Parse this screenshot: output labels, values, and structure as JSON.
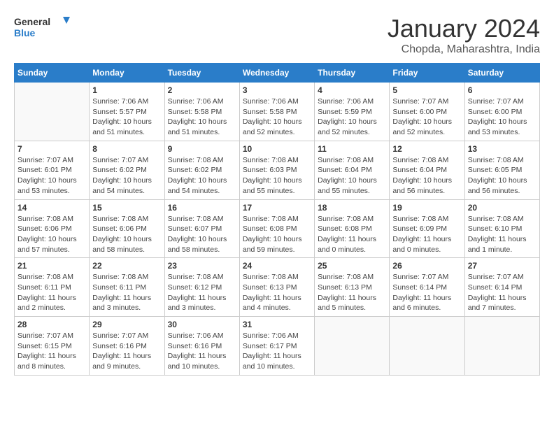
{
  "header": {
    "logo_general": "General",
    "logo_blue": "Blue",
    "month_year": "January 2024",
    "location": "Chopda, Maharashtra, India"
  },
  "weekdays": [
    "Sunday",
    "Monday",
    "Tuesday",
    "Wednesday",
    "Thursday",
    "Friday",
    "Saturday"
  ],
  "weeks": [
    [
      {
        "day": "",
        "info": ""
      },
      {
        "day": "1",
        "info": "Sunrise: 7:06 AM\nSunset: 5:57 PM\nDaylight: 10 hours\nand 51 minutes."
      },
      {
        "day": "2",
        "info": "Sunrise: 7:06 AM\nSunset: 5:58 PM\nDaylight: 10 hours\nand 51 minutes."
      },
      {
        "day": "3",
        "info": "Sunrise: 7:06 AM\nSunset: 5:58 PM\nDaylight: 10 hours\nand 52 minutes."
      },
      {
        "day": "4",
        "info": "Sunrise: 7:06 AM\nSunset: 5:59 PM\nDaylight: 10 hours\nand 52 minutes."
      },
      {
        "day": "5",
        "info": "Sunrise: 7:07 AM\nSunset: 6:00 PM\nDaylight: 10 hours\nand 52 minutes."
      },
      {
        "day": "6",
        "info": "Sunrise: 7:07 AM\nSunset: 6:00 PM\nDaylight: 10 hours\nand 53 minutes."
      }
    ],
    [
      {
        "day": "7",
        "info": "Sunrise: 7:07 AM\nSunset: 6:01 PM\nDaylight: 10 hours\nand 53 minutes."
      },
      {
        "day": "8",
        "info": "Sunrise: 7:07 AM\nSunset: 6:02 PM\nDaylight: 10 hours\nand 54 minutes."
      },
      {
        "day": "9",
        "info": "Sunrise: 7:08 AM\nSunset: 6:02 PM\nDaylight: 10 hours\nand 54 minutes."
      },
      {
        "day": "10",
        "info": "Sunrise: 7:08 AM\nSunset: 6:03 PM\nDaylight: 10 hours\nand 55 minutes."
      },
      {
        "day": "11",
        "info": "Sunrise: 7:08 AM\nSunset: 6:04 PM\nDaylight: 10 hours\nand 55 minutes."
      },
      {
        "day": "12",
        "info": "Sunrise: 7:08 AM\nSunset: 6:04 PM\nDaylight: 10 hours\nand 56 minutes."
      },
      {
        "day": "13",
        "info": "Sunrise: 7:08 AM\nSunset: 6:05 PM\nDaylight: 10 hours\nand 56 minutes."
      }
    ],
    [
      {
        "day": "14",
        "info": "Sunrise: 7:08 AM\nSunset: 6:06 PM\nDaylight: 10 hours\nand 57 minutes."
      },
      {
        "day": "15",
        "info": "Sunrise: 7:08 AM\nSunset: 6:06 PM\nDaylight: 10 hours\nand 58 minutes."
      },
      {
        "day": "16",
        "info": "Sunrise: 7:08 AM\nSunset: 6:07 PM\nDaylight: 10 hours\nand 58 minutes."
      },
      {
        "day": "17",
        "info": "Sunrise: 7:08 AM\nSunset: 6:08 PM\nDaylight: 10 hours\nand 59 minutes."
      },
      {
        "day": "18",
        "info": "Sunrise: 7:08 AM\nSunset: 6:08 PM\nDaylight: 11 hours\nand 0 minutes."
      },
      {
        "day": "19",
        "info": "Sunrise: 7:08 AM\nSunset: 6:09 PM\nDaylight: 11 hours\nand 0 minutes."
      },
      {
        "day": "20",
        "info": "Sunrise: 7:08 AM\nSunset: 6:10 PM\nDaylight: 11 hours\nand 1 minute."
      }
    ],
    [
      {
        "day": "21",
        "info": "Sunrise: 7:08 AM\nSunset: 6:11 PM\nDaylight: 11 hours\nand 2 minutes."
      },
      {
        "day": "22",
        "info": "Sunrise: 7:08 AM\nSunset: 6:11 PM\nDaylight: 11 hours\nand 3 minutes."
      },
      {
        "day": "23",
        "info": "Sunrise: 7:08 AM\nSunset: 6:12 PM\nDaylight: 11 hours\nand 3 minutes."
      },
      {
        "day": "24",
        "info": "Sunrise: 7:08 AM\nSunset: 6:13 PM\nDaylight: 11 hours\nand 4 minutes."
      },
      {
        "day": "25",
        "info": "Sunrise: 7:08 AM\nSunset: 6:13 PM\nDaylight: 11 hours\nand 5 minutes."
      },
      {
        "day": "26",
        "info": "Sunrise: 7:07 AM\nSunset: 6:14 PM\nDaylight: 11 hours\nand 6 minutes."
      },
      {
        "day": "27",
        "info": "Sunrise: 7:07 AM\nSunset: 6:14 PM\nDaylight: 11 hours\nand 7 minutes."
      }
    ],
    [
      {
        "day": "28",
        "info": "Sunrise: 7:07 AM\nSunset: 6:15 PM\nDaylight: 11 hours\nand 8 minutes."
      },
      {
        "day": "29",
        "info": "Sunrise: 7:07 AM\nSunset: 6:16 PM\nDaylight: 11 hours\nand 9 minutes."
      },
      {
        "day": "30",
        "info": "Sunrise: 7:06 AM\nSunset: 6:16 PM\nDaylight: 11 hours\nand 10 minutes."
      },
      {
        "day": "31",
        "info": "Sunrise: 7:06 AM\nSunset: 6:17 PM\nDaylight: 11 hours\nand 10 minutes."
      },
      {
        "day": "",
        "info": ""
      },
      {
        "day": "",
        "info": ""
      },
      {
        "day": "",
        "info": ""
      }
    ]
  ]
}
